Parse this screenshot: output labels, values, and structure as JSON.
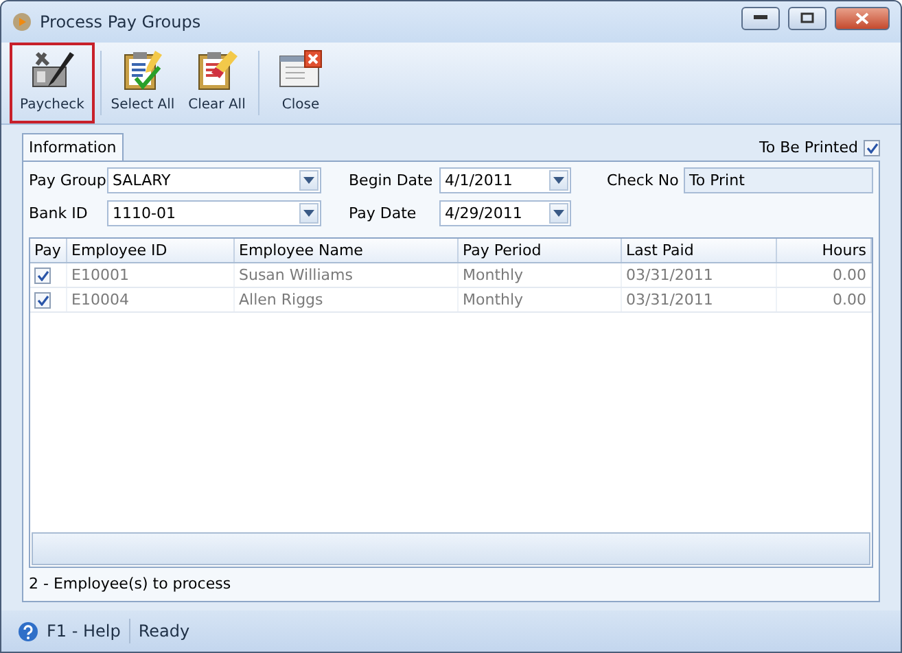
{
  "window": {
    "title": "Process Pay Groups"
  },
  "toolbar": [
    {
      "label": "Paycheck",
      "kind": "paycheck",
      "highlighted": true
    },
    {
      "label": "Select All",
      "kind": "select",
      "highlighted": false
    },
    {
      "label": "Clear All",
      "kind": "clear",
      "highlighted": false
    },
    {
      "label": "Close",
      "kind": "close",
      "highlighted": false
    }
  ],
  "tabs": [
    {
      "label": "Information",
      "selected": true
    }
  ],
  "to_be_printed": {
    "label": "To Be Printed",
    "checked": true
  },
  "fields": {
    "pay_group": {
      "label": "Pay Group",
      "value": "SALARY"
    },
    "bank_id": {
      "label": "Bank ID",
      "value": "1110-01"
    },
    "begin_date": {
      "label": "Begin Date",
      "value": "4/1/2011"
    },
    "pay_date": {
      "label": "Pay Date",
      "value": "4/29/2011"
    },
    "check_no": {
      "label": "Check No",
      "value": "To Print"
    }
  },
  "table": {
    "columns": [
      "Pay",
      "Employee ID",
      "Employee Name",
      "Pay Period",
      "Last Paid",
      "Hours"
    ],
    "rows": [
      {
        "cells": [
          {
            "kind": "checkbox",
            "checked": true
          },
          "E10001",
          "Susan Williams",
          "Monthly",
          "03/31/2011",
          "0.00"
        ]
      },
      {
        "cells": [
          {
            "kind": "checkbox",
            "checked": true
          },
          "E10004",
          "Allen Riggs",
          "Monthly",
          "03/31/2011",
          "0.00"
        ]
      }
    ]
  },
  "summary": "2 -  Employee(s) to process",
  "status_bar": {
    "help": "F1 - Help",
    "status": "Ready"
  }
}
